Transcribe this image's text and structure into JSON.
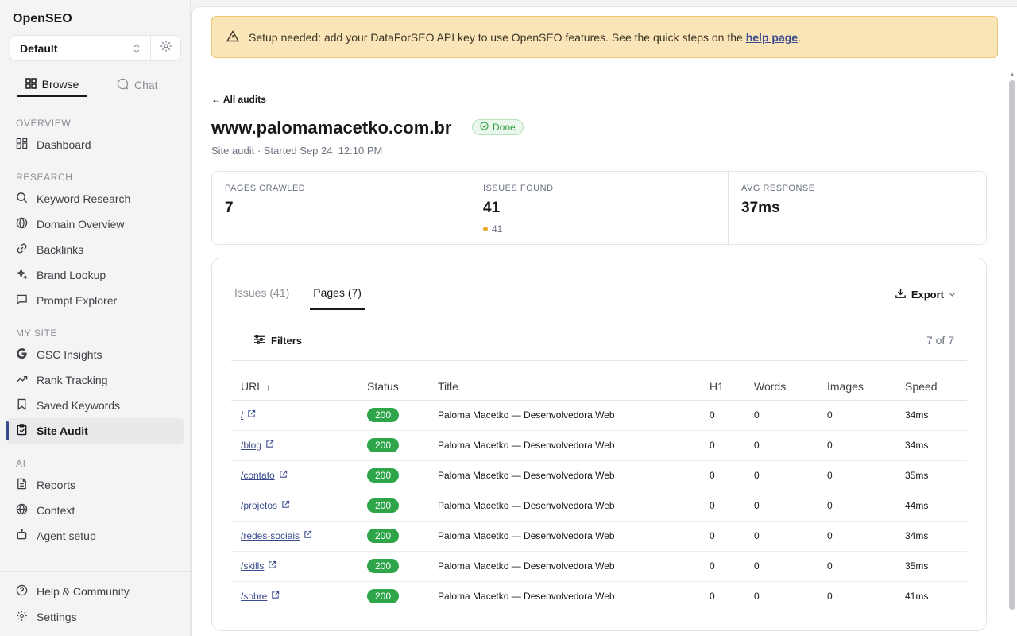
{
  "app": {
    "title": "OpenSEO"
  },
  "project": {
    "selected": "Default"
  },
  "mode_tabs": [
    {
      "label": "Browse",
      "icon": "grid-icon",
      "active": true
    },
    {
      "label": "Chat",
      "icon": "chat-bubble-icon",
      "active": false
    }
  ],
  "sidebar": {
    "sections": [
      {
        "label": "OVERVIEW",
        "items": [
          {
            "label": "Dashboard",
            "icon": "dashboard-icon"
          }
        ]
      },
      {
        "label": "RESEARCH",
        "items": [
          {
            "label": "Keyword Research",
            "icon": "search-icon"
          },
          {
            "label": "Domain Overview",
            "icon": "globe-icon"
          },
          {
            "label": "Backlinks",
            "icon": "link-icon"
          },
          {
            "label": "Brand Lookup",
            "icon": "sparkle-icon"
          },
          {
            "label": "Prompt Explorer",
            "icon": "message-square-icon"
          }
        ]
      },
      {
        "label": "MY SITE",
        "items": [
          {
            "label": "GSC Insights",
            "icon": "google-icon"
          },
          {
            "label": "Rank Tracking",
            "icon": "trending-up-icon"
          },
          {
            "label": "Saved Keywords",
            "icon": "bookmark-icon"
          },
          {
            "label": "Site Audit",
            "icon": "clipboard-check-icon",
            "active": true
          }
        ]
      },
      {
        "label": "AI",
        "items": [
          {
            "label": "Reports",
            "icon": "file-text-icon"
          },
          {
            "label": "Context",
            "icon": "globe-icon"
          },
          {
            "label": "Agent setup",
            "icon": "bot-icon"
          }
        ]
      }
    ],
    "footer": [
      {
        "label": "Help & Community",
        "icon": "help-circle-icon"
      },
      {
        "label": "Settings",
        "icon": "gear-icon"
      }
    ]
  },
  "banner": {
    "text": "Setup needed: add your DataForSEO API key to use OpenSEO features. See the quick steps on the",
    "link": "help page",
    "suffix": ".",
    "icon": "warning-triangle-icon",
    "color": "#fae5b8"
  },
  "audit": {
    "back_label": "← All audits",
    "domain": "www.palomamacetko.com.br",
    "status": "Done",
    "subtitle": "Site audit · Started Sep 24, 12:10 PM"
  },
  "stats": [
    {
      "label": "PAGES CRAWLED",
      "value": "7"
    },
    {
      "label": "ISSUES FOUND",
      "value": "41",
      "sub": "41"
    },
    {
      "label": "AVG RESPONSE",
      "value": "37ms"
    }
  ],
  "results": {
    "tabs": [
      {
        "label": "Issues (41)",
        "active": false
      },
      {
        "label": "Pages (7)",
        "active": true
      }
    ],
    "export_label": "Export",
    "filters_label": "Filters",
    "count_label": "7 of 7",
    "columns": [
      "URL",
      "Status",
      "Title",
      "H1",
      "Words",
      "Images",
      "Speed"
    ],
    "rows": [
      {
        "url": "/",
        "status": "200",
        "title": "Paloma Macetko — Desenvolvedora Web",
        "h1": "0",
        "words": "0",
        "images": "0",
        "speed": "34ms"
      },
      {
        "url": "/blog",
        "status": "200",
        "title": "Paloma Macetko — Desenvolvedora Web",
        "h1": "0",
        "words": "0",
        "images": "0",
        "speed": "34ms"
      },
      {
        "url": "/contato",
        "status": "200",
        "title": "Paloma Macetko — Desenvolvedora Web",
        "h1": "0",
        "words": "0",
        "images": "0",
        "speed": "35ms"
      },
      {
        "url": "/projetos",
        "status": "200",
        "title": "Paloma Macetko — Desenvolvedora Web",
        "h1": "0",
        "words": "0",
        "images": "0",
        "speed": "44ms"
      },
      {
        "url": "/redes-sociais",
        "status": "200",
        "title": "Paloma Macetko — Desenvolvedora Web",
        "h1": "0",
        "words": "0",
        "images": "0",
        "speed": "34ms"
      },
      {
        "url": "/skills",
        "status": "200",
        "title": "Paloma Macetko — Desenvolvedora Web",
        "h1": "0",
        "words": "0",
        "images": "0",
        "speed": "35ms"
      },
      {
        "url": "/sobre",
        "status": "200",
        "title": "Paloma Macetko — Desenvolvedora Web",
        "h1": "0",
        "words": "0",
        "images": "0",
        "speed": "41ms"
      }
    ],
    "status_color": "#2fa54a"
  }
}
